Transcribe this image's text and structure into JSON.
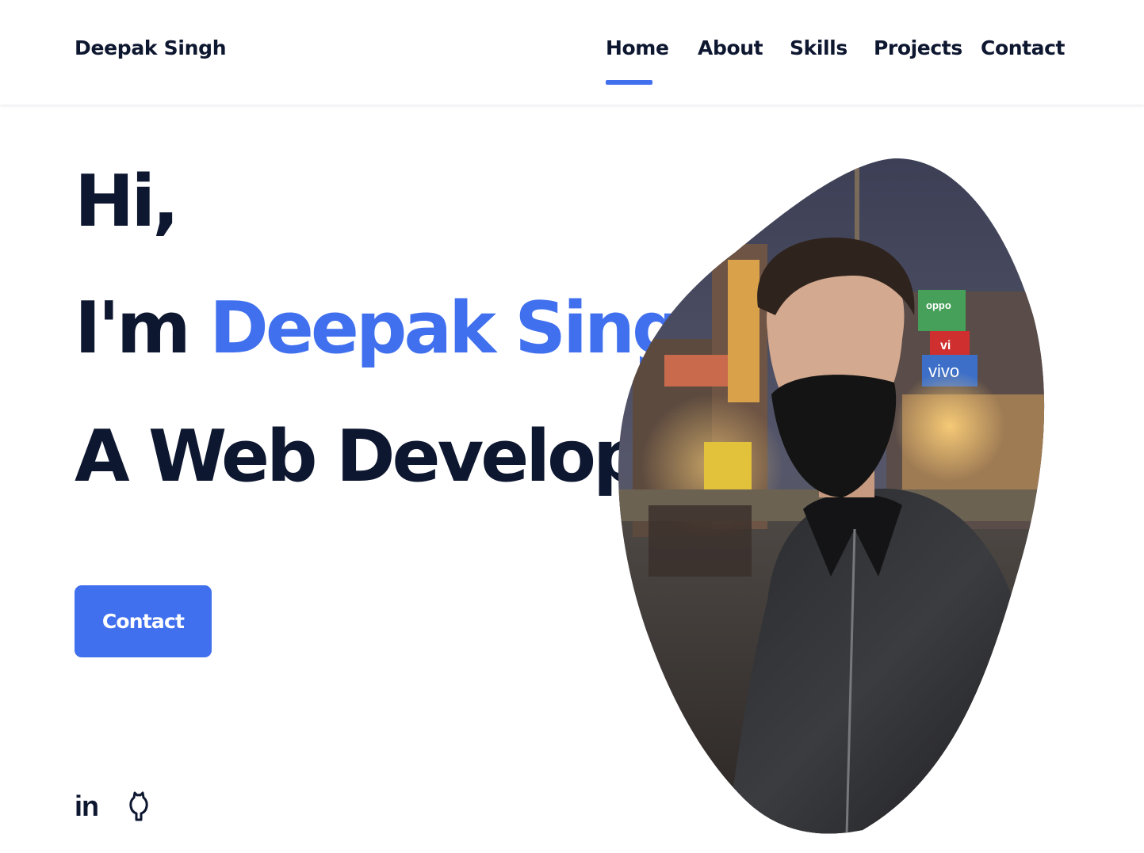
{
  "header": {
    "logo": "Deepak Singh",
    "nav": [
      "Home",
      "About",
      "Skills",
      "Projects",
      "Contact"
    ],
    "active": "Home"
  },
  "hero": {
    "greeting": "Hi,",
    "intro_prefix": "I'm ",
    "name": "Deepak Singh",
    "role": "A Web Developer",
    "contact_button": "Contact"
  },
  "social": {
    "linkedin_text": "in",
    "icons": [
      "linkedin-icon",
      "github-icon"
    ]
  },
  "photo": {
    "shop_signs": [
      "oppo",
      "vi",
      "vivo"
    ]
  },
  "colors": {
    "accent": "#4170ef",
    "text": "#0e1730",
    "background": "#ffffff"
  }
}
